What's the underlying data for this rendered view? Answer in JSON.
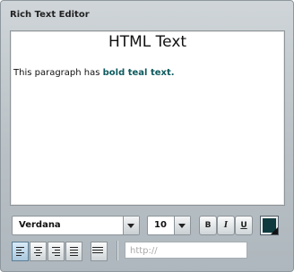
{
  "window": {
    "title": "Rich Text Editor"
  },
  "editor": {
    "heading": "HTML Text",
    "paragraph_prefix": "This paragraph has ",
    "paragraph_bold": "bold teal text.",
    "bold_color": "#0e5a5e"
  },
  "toolbar": {
    "font_family": "Verdana",
    "font_size": "10",
    "bold_label": "B",
    "italic_label": "I",
    "underline_label": "U",
    "text_color": "#0e3a3e",
    "align_buttons": [
      "align-left",
      "align-center",
      "align-right",
      "align-justify"
    ],
    "active_align": "align-left",
    "link_placeholder": "http://"
  }
}
